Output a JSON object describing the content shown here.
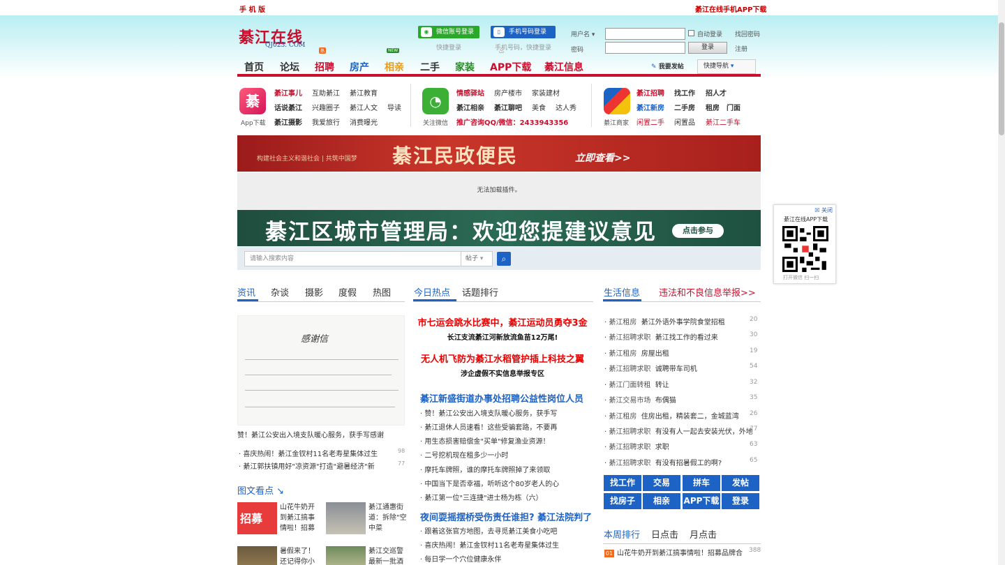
{
  "topbar": {
    "mobile": "手 机 版",
    "app_download": "綦江在线手机APP下载"
  },
  "logo": {
    "main": "綦江在线",
    "sub": "QJ023. COM"
  },
  "login": {
    "wechat_btn": "微信账号登录",
    "wechat_sub": "快捷登录",
    "phone_btn": "手机号码登录",
    "phone_sub": "手机号码，快捷登录",
    "username_label": "用户名",
    "password_label": "密码",
    "auto_login": "自动登录",
    "forgot": "找回密码",
    "submit": "登录",
    "register": "注册"
  },
  "nav": {
    "items": [
      "首页",
      "论坛",
      "招聘",
      "房产",
      "相亲",
      "二手",
      "家装",
      "APP下载",
      "綦江信息"
    ],
    "hot_badge": "热",
    "new_badge": "NEW",
    "post": "我要发帖",
    "quick_nav": "快捷导航"
  },
  "links": {
    "col1_icon": "App下载",
    "col1": [
      [
        "綦江事儿",
        "互助綦江",
        "綦江教育"
      ],
      [
        "话说綦江",
        "兴趣圈子",
        "綦江人文",
        "导读"
      ],
      [
        "綦江摄影",
        "我爱旅行",
        "消费曝光"
      ]
    ],
    "col2_icon": "关注微信",
    "col2": [
      [
        "情感驿站",
        "房产楼市",
        "家装建材"
      ],
      [
        "綦江相亲",
        "綦江聊吧",
        "美食",
        "达人秀"
      ],
      [
        "推广咨询QQ/微信：2433943356"
      ]
    ],
    "col3_icon": "綦江商家",
    "col3": [
      [
        "綦江招聘",
        "找工作",
        "招人才"
      ],
      [
        "綦江新房",
        "二手房",
        "租房",
        "门面"
      ],
      [
        "闲置二手",
        "闲置品",
        "綦江二手车"
      ]
    ]
  },
  "banner1": {
    "slogan": "构建社会主义和谐社会 | 共筑中国梦",
    "title": "綦江民政便民",
    "cta": "立即查看>>"
  },
  "plugin": {
    "text": "无法加载插件。"
  },
  "banner2": {
    "title": "綦江区城市管理局：欢迎您提建议意见",
    "cta": "点击参与"
  },
  "search": {
    "placeholder": "请输入搜索内容",
    "scope": "帖子"
  },
  "left": {
    "tabs": [
      "资讯",
      "杂谈",
      "摄影",
      "度假",
      "热图"
    ],
    "photo_title": "感谢信",
    "caption": "赞！綦江公安出入境支队暖心服务，获手写感谢",
    "news": [
      {
        "title": "喜庆热闹！綦江金钗村11名老寿星集体过生",
        "n": "98"
      },
      {
        "title": "綦江郭扶镇用好\"凉资源\"打造\"避暑经济\"新",
        "n": "77"
      }
    ],
    "gallery_title": "图文看点",
    "gallery": [
      {
        "text": "山花牛奶开到綦江搞事情啦！招募",
        "thumb": "招募"
      },
      {
        "text": "綦江通惠街道：拆除\"空中菜"
      },
      {
        "text": "暑假来了！还记得你小"
      },
      {
        "text": "綦江交巡警最新一批酒"
      }
    ]
  },
  "center": {
    "tabs": [
      "今日热点",
      "话题排行"
    ],
    "headlines": [
      {
        "t": "市七运会跳水比赛中，綦江运动员勇夺3金",
        "s": "长江支流綦江河新放流鱼苗12万尾!"
      },
      {
        "t": "无人机飞防为綦江水稻管护插上科技之翼",
        "s": "涉企虚假不实信息举报专区"
      }
    ],
    "blue1": "綦江新盛街道办事处招聘公益性岗位人员",
    "list1": [
      "赞！綦江公安出入境支队暖心服务，获手写",
      "綦江退休人员速看！这些受骗套路，不要再",
      "用生态损害赔偿金\"买单\"修复渔业资源！",
      "二号挖机现在租多少一小时",
      "摩托车牌照，谁的摩托车牌照掉了来领取",
      "中国当下是否幸福，听听这个80岁老人的心",
      "綦江第一位\"三连捷\"进士杨为栋（六）"
    ],
    "blue2": "夜间耍摇摆桥受伤责任谁担? 綦江法院判了",
    "list2": [
      "跟着这张官方地图，去寻觅綦江美食小吃吧",
      "喜庆热闹！綦江金钗村11名老寿星集体过生",
      "每日学一个穴位健康永伴"
    ]
  },
  "right": {
    "tab": "生活信息",
    "report": "违法和不良信息举报>>",
    "list": [
      {
        "c": "綦江租房",
        "t": "綦江外语外事学院食堂招租",
        "n": "20"
      },
      {
        "c": "綦江招聘求职",
        "t": "綦江找工作的看过来",
        "n": "30"
      },
      {
        "c": "綦江租房",
        "t": "房屋出租",
        "n": "19"
      },
      {
        "c": "綦江招聘求职",
        "t": "诚聘带车司机",
        "n": "54"
      },
      {
        "c": "綦江门面转租",
        "t": "转让",
        "n": "32"
      },
      {
        "c": "綦江交易市场",
        "t": "布偶猫",
        "n": "35"
      },
      {
        "c": "綦江租房",
        "t": "住房出租，精装套二，金城蓝湾",
        "n": "26"
      },
      {
        "c": "綦江招聘求职",
        "t": "有没有人一起去安装光伏，外地",
        "n": "77"
      },
      {
        "c": "綦江招聘求职",
        "t": "求职",
        "n": "63"
      },
      {
        "c": "綦江招聘求职",
        "t": "有没有招暑假工的啊?",
        "n": "65"
      }
    ],
    "buttons": [
      "找工作",
      "交易",
      "拼车",
      "发帖",
      "找房子",
      "相亲",
      "APP下载",
      "登录"
    ],
    "rank_tabs": [
      "本周排行",
      "日点击",
      "月点击"
    ],
    "rank": [
      {
        "num": "01",
        "t": "山花牛奶开到綦江搞事情啦！招募品牌合",
        "n": "388"
      }
    ]
  },
  "qr": {
    "close": "关闭",
    "title": "綦江在线APP下载",
    "foot": "打开微信  扫一扫"
  },
  "colors": {
    "brand_red": "#c8102e",
    "brand_blue": "#1d62c5",
    "wechat_green": "#2aa82a"
  }
}
